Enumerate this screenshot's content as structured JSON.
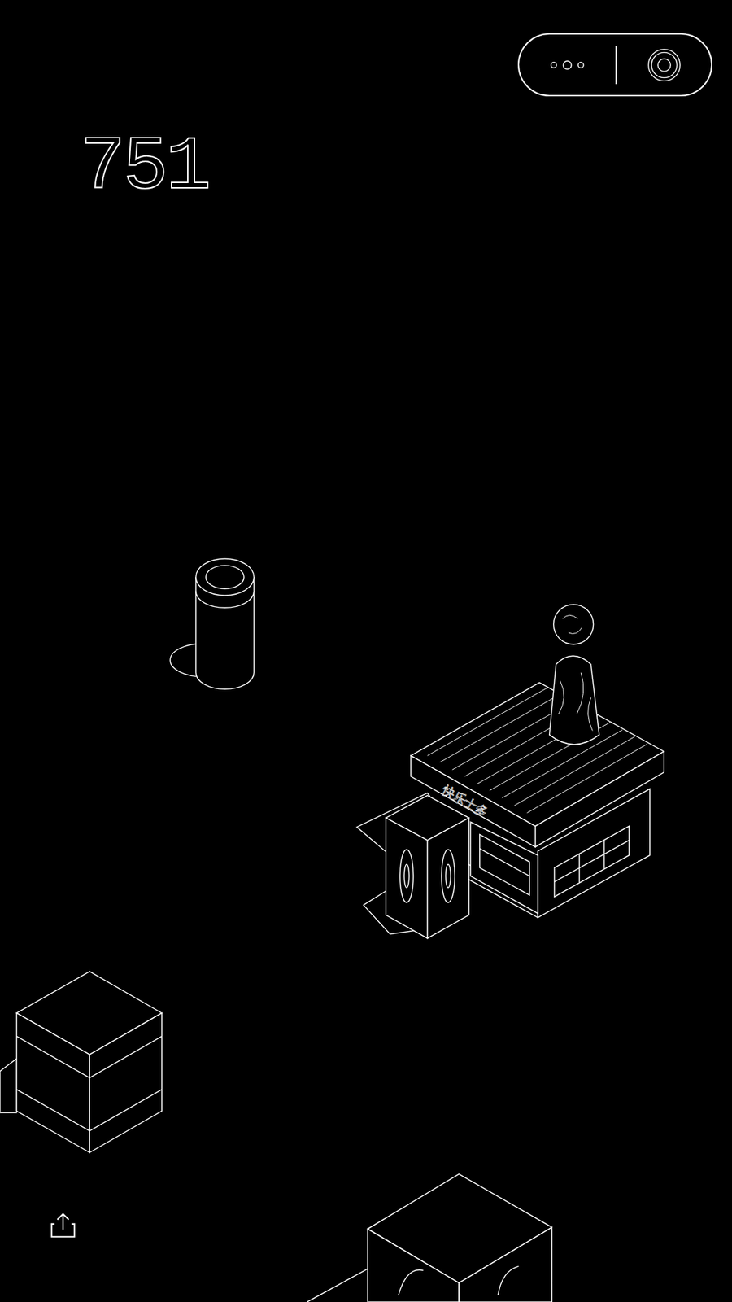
{
  "score": "751",
  "shop": {
    "sign": "快乐士多"
  }
}
